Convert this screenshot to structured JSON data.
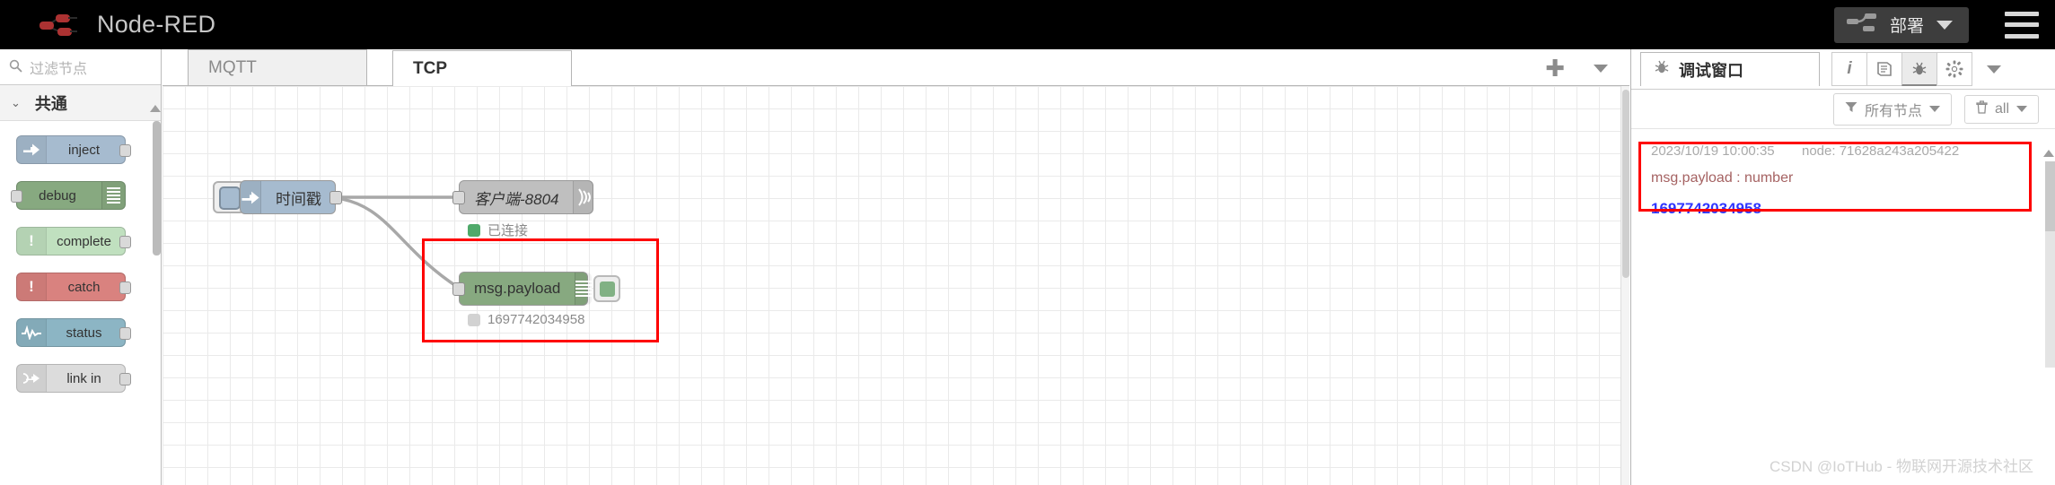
{
  "header": {
    "brand_title": "Node-RED",
    "logo_icon": "node-red-logo-icon",
    "deploy_label": "部署",
    "deploy_icon": "deploy-node-icon",
    "deploy_caret_icon": "chevron-down-icon",
    "menu_icon": "hamburger-menu-icon"
  },
  "palette": {
    "search_placeholder": "过滤节点",
    "search_icon": "search-icon",
    "category_label": "共通",
    "category_caret_icon": "chevron-down-icon",
    "nodes": [
      {
        "label": "inject",
        "icon": "inject-arrow-icon",
        "bg": "#a6bbcf",
        "icon_glyph": "⇨",
        "has_out": true,
        "has_in": false,
        "has_bars": false
      },
      {
        "label": "debug",
        "icon": "debug-bars-icon",
        "bg": "#87a980",
        "icon_glyph": "",
        "has_out": false,
        "has_in": true,
        "has_bars": true
      },
      {
        "label": "complete",
        "icon": "exclamation-icon",
        "bg": "#c0e0bf",
        "icon_glyph": "!",
        "has_out": true,
        "has_in": false,
        "has_bars": false
      },
      {
        "label": "catch",
        "icon": "exclamation-icon",
        "bg": "#d9827f",
        "icon_glyph": "!",
        "has_out": true,
        "has_in": false,
        "has_bars": false
      },
      {
        "label": "status",
        "icon": "pulse-wave-icon",
        "bg": "#8cb5c4",
        "icon_glyph": "∿",
        "has_out": true,
        "has_in": false,
        "has_bars": false
      },
      {
        "label": "link in",
        "icon": "link-in-icon",
        "bg": "#dcdcdc",
        "icon_glyph": "⇾",
        "has_out": true,
        "has_in": false,
        "has_bars": false
      }
    ]
  },
  "workspace": {
    "tabs": [
      {
        "label": "MQTT",
        "active": false
      },
      {
        "label": "TCP",
        "active": true
      }
    ],
    "add_tab_icon": "plus-icon",
    "tab_menu_icon": "chevron-down-icon",
    "flow_nodes": [
      {
        "name": "inject-node",
        "label": "时间戳",
        "icon": "inject-arrow-icon",
        "bg": "#a6bbcf",
        "status": null
      },
      {
        "name": "tcp-client-node",
        "label": "客户端-8804",
        "icon": "tcp-signal-icon",
        "bg": "#bfbfbf",
        "status": {
          "text": "已连接",
          "color": "#4fa96a"
        }
      },
      {
        "name": "debug-node",
        "label": "msg.payload",
        "icon": "debug-bars-icon",
        "bg": "#87a980",
        "status": {
          "text": "1697742034958",
          "color": "#d2d2d2"
        }
      }
    ]
  },
  "sidebar": {
    "tab_label": "调试窗口",
    "tab_icon": "bug-icon",
    "icon_buttons": [
      {
        "name": "info-icon",
        "glyph": "i",
        "active": false
      },
      {
        "name": "book-icon",
        "glyph": "▤",
        "active": false
      },
      {
        "name": "bug-icon",
        "glyph": "🐞",
        "active": true
      },
      {
        "name": "gear-icon",
        "glyph": "✿",
        "active": false
      }
    ],
    "panel_caret_icon": "chevron-down-icon",
    "filter_nodes": {
      "label": "所有节点",
      "icon": "filter-icon",
      "caret": "chevron-down-icon"
    },
    "clear_all": {
      "label": "all",
      "icon": "trash-icon",
      "caret": "chevron-down-icon"
    },
    "messages": [
      {
        "timestamp": "2023/10/19 10:00:35",
        "node": "node: 71628a243a205422",
        "property": "msg.payload : number",
        "value": "1697742034958"
      }
    ],
    "watermark": "CSDN @IoTHub - 物联网开源技术社区"
  }
}
